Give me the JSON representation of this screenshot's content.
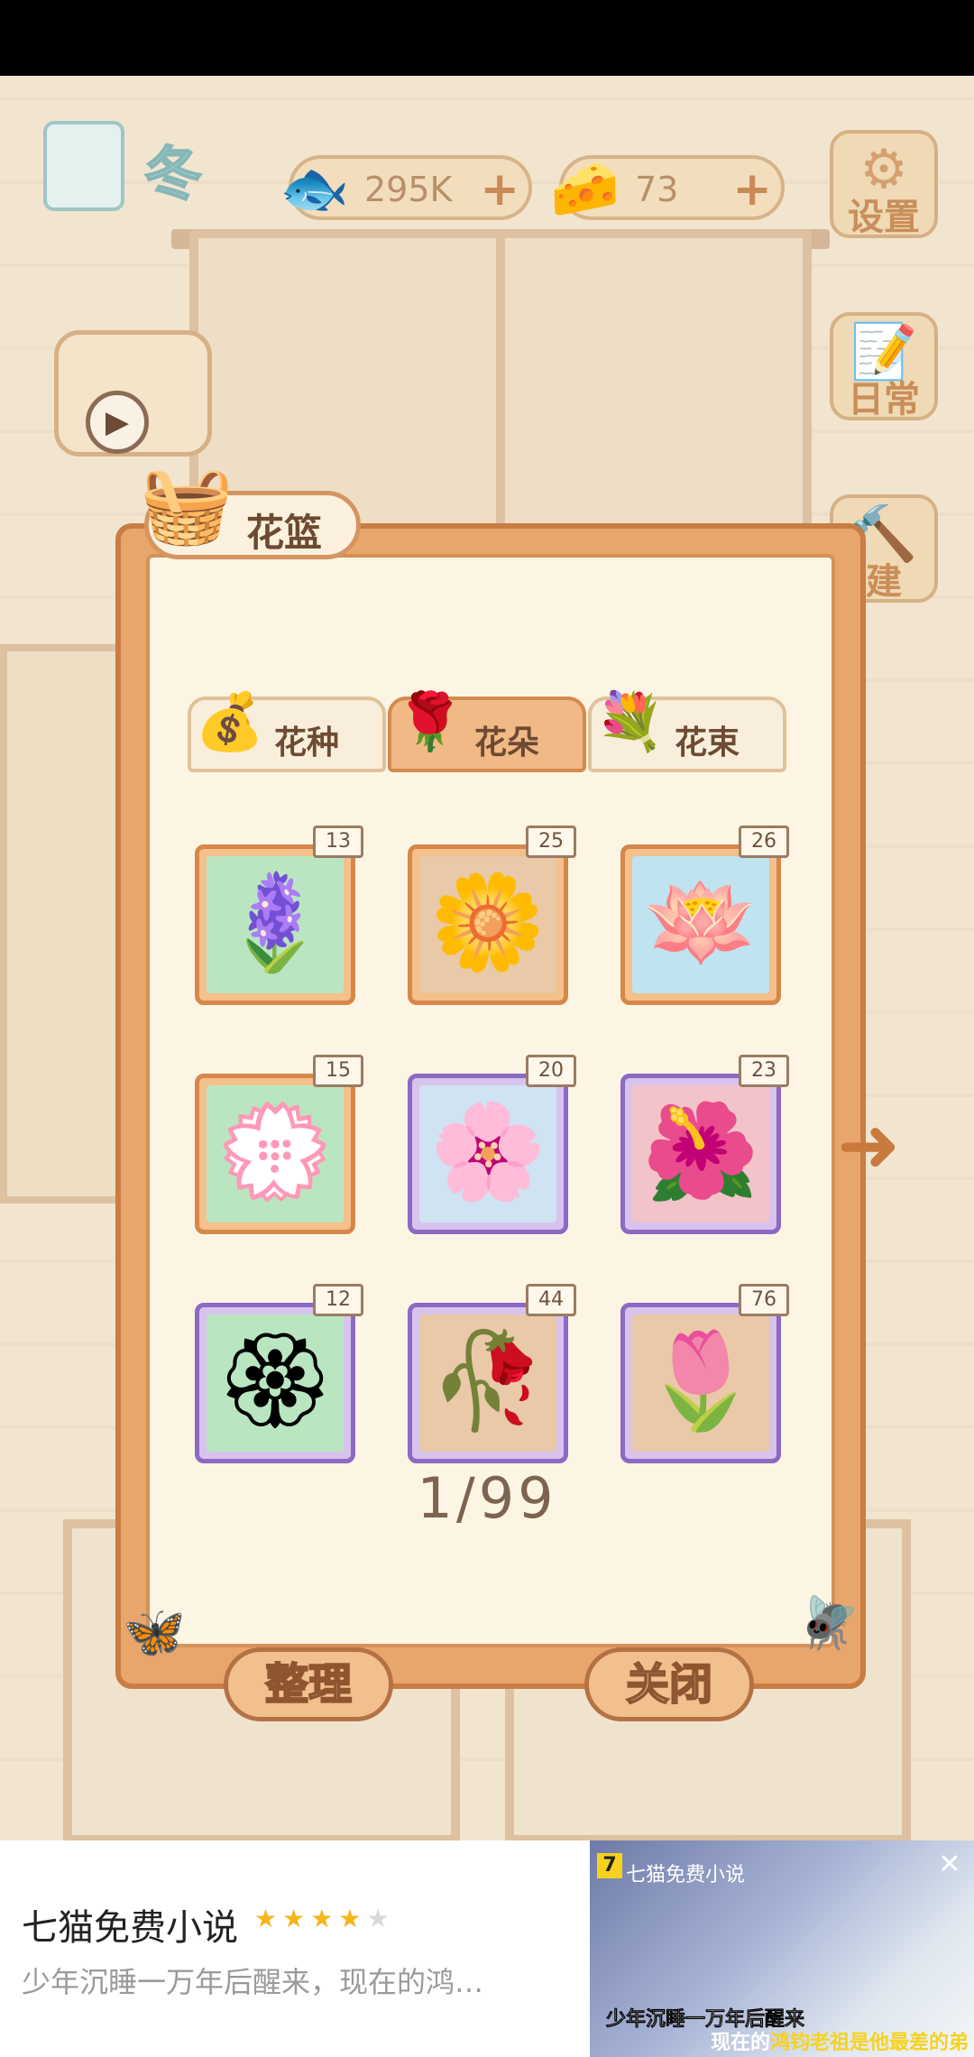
{
  "hud": {
    "season_label": "冬",
    "fish_value": "295K",
    "cheese_value": "73",
    "plus_symbol": "+",
    "settings_label": "设置",
    "daily_label": "日常",
    "build_label": "建"
  },
  "dialog": {
    "title": "花篮",
    "tabs": [
      {
        "label": "花种",
        "icon": "seed-bag-icon",
        "active": false
      },
      {
        "label": "花朵",
        "icon": "rose-icon",
        "active": true
      },
      {
        "label": "花束",
        "icon": "bouquet-icon",
        "active": false
      }
    ],
    "items": [
      {
        "count": "13",
        "bg": "#b9e6c0",
        "frame": "orange",
        "glyph": "🪻"
      },
      {
        "count": "25",
        "bg": "#e9c9a8",
        "frame": "orange",
        "glyph": "🌼"
      },
      {
        "count": "26",
        "bg": "#bfe3ef",
        "frame": "orange",
        "glyph": "🪷"
      },
      {
        "count": "15",
        "bg": "#b9e6c0",
        "frame": "orange",
        "glyph": "💮"
      },
      {
        "count": "20",
        "bg": "#cfe3f3",
        "frame": "purple",
        "glyph": "🌸"
      },
      {
        "count": "23",
        "bg": "#f2c3c9",
        "frame": "purple",
        "glyph": "🌺"
      },
      {
        "count": "12",
        "bg": "#b9e6c0",
        "frame": "purple",
        "glyph": "🏵"
      },
      {
        "count": "44",
        "bg": "#e9c9a8",
        "frame": "purple",
        "glyph": "🥀"
      },
      {
        "count": "76",
        "bg": "#e9c9a8",
        "frame": "purple",
        "glyph": "🌷"
      }
    ],
    "page_indicator": "1/99",
    "sort_label": "整理",
    "close_label": "关闭"
  },
  "ad": {
    "title": "七猫免费小说",
    "rating": 4,
    "description": "少年沉睡一万年后醒来，现在的鸿…",
    "brand": "七猫免费小说",
    "caption_line1": "少年沉睡一万年后醒来",
    "caption_line2_prefix": "现在的",
    "caption_line2_highlight": "鸿钧老祖是他最差的弟子"
  }
}
